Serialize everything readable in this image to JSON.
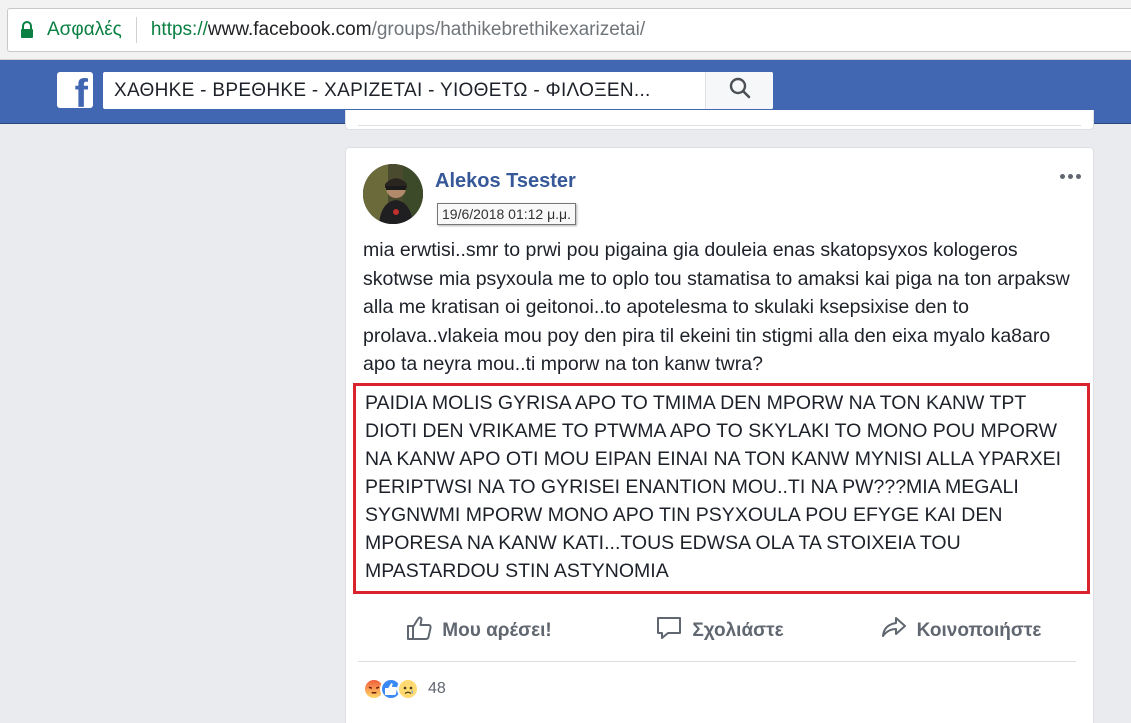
{
  "browser": {
    "secure_label": "Ασφαλές",
    "url_protocol": "https://",
    "url_host": "www.facebook.com",
    "url_path": "/groups/hathikebrethikexarizetai/"
  },
  "fb_header": {
    "logo": "f",
    "search_text": "ΧΑΘΗΚΕ - ΒΡΕΘΗΚΕ - ΧΑΡΙΖΕΤΑΙ - ΥΙΟΘΕΤΩ - ΦΙΛΟΞΕΝ...",
    "search_icon": "magnifier-icon"
  },
  "post": {
    "author": "Alekos Tsester",
    "timestamp": "19/6/2018 01:12 μ.μ.",
    "text": "mia erwtisi..smr to prwi pou pigaina gia douleia enas skatopsyxos kologeros skotwse mia psyxoula me to oplo tou stamatisa to amaksi kai piga na ton arpaksw alla me kratisan oi geitonoi..to apotelesma to skulaki ksepsixise den to prolava..vlakeia mou poy den pira til ekeini tin stigmi alla den eixa myalo ka8aro apo ta neyra mou..ti mporw na ton kanw twra?",
    "update_text": "PAIDIA MOLIS GYRISA APO TO TMIMA DEN MPORW NA TON KANW TPT DIOTI DEN VRIKAME TO PTWMA APO TO SKYLAKI TO MONO POU MPORW NA KANW APO OTI MOU EIPAN EINAI NA TON KANW MYNISI ALLA YPARXEI PERIPTWSI NA TO GYRISEI ENANTION MOU..TI NA PW???MIA MEGALI SYGNWMI MPORW MONO APO TIN PSYXOULA POU EFYGE KAI DEN MPORESA NA KANW KATI...TOUS EDWSA OLA TA STOIXEIA TOU MPASTARDOU STIN ASTYNOMIA",
    "highlight_color": "#d9232d",
    "actions": {
      "like": "Μου αρέσει!",
      "comment": "Σχολιάστε",
      "share": "Κοινοποιήστε"
    },
    "reactions": {
      "icons": [
        "angry-icon",
        "like-icon",
        "sad-icon"
      ],
      "count": "48"
    }
  }
}
